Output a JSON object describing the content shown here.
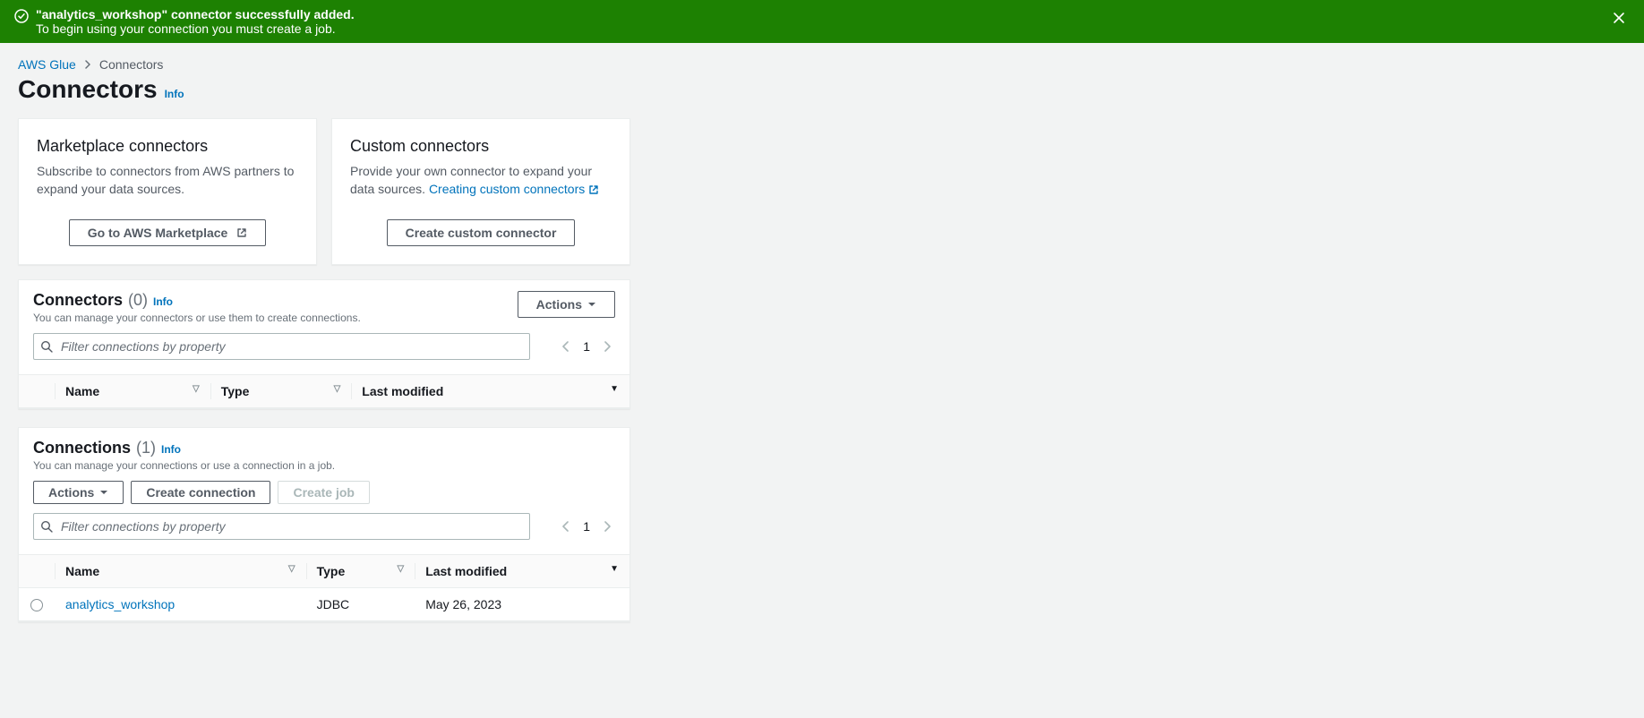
{
  "alert": {
    "title": "\"analytics_workshop\" connector successfully added.",
    "desc": "To begin using your connection you must create a job."
  },
  "breadcrumb": {
    "root": "AWS Glue",
    "current": "Connectors"
  },
  "page": {
    "title": "Connectors",
    "info": "Info"
  },
  "cards": {
    "marketplace": {
      "title": "Marketplace connectors",
      "desc": "Subscribe to connectors from AWS partners to expand your data sources.",
      "button": "Go to AWS Marketplace"
    },
    "custom": {
      "title": "Custom connectors",
      "desc_prefix": "Provide your own connector to expand your data sources. ",
      "link": "Creating custom connectors",
      "button": "Create custom connector"
    }
  },
  "connectors_panel": {
    "title": "Connectors",
    "count": "(0)",
    "info": "Info",
    "desc": "You can manage your connectors or use them to create connections.",
    "actions": "Actions",
    "filter_placeholder": "Filter connections by property",
    "page": "1",
    "headers": {
      "name": "Name",
      "type": "Type",
      "last_modified": "Last modified"
    }
  },
  "connections_panel": {
    "title": "Connections",
    "count": "(1)",
    "info": "Info",
    "desc": "You can manage your connections or use a connection in a job.",
    "actions": "Actions",
    "create_connection": "Create connection",
    "create_job": "Create job",
    "filter_placeholder": "Filter connections by property",
    "page": "1",
    "headers": {
      "name": "Name",
      "type": "Type",
      "last_modified": "Last modified"
    },
    "rows": [
      {
        "name": "analytics_workshop",
        "type": "JDBC",
        "last_modified": "May 26, 2023"
      }
    ]
  }
}
